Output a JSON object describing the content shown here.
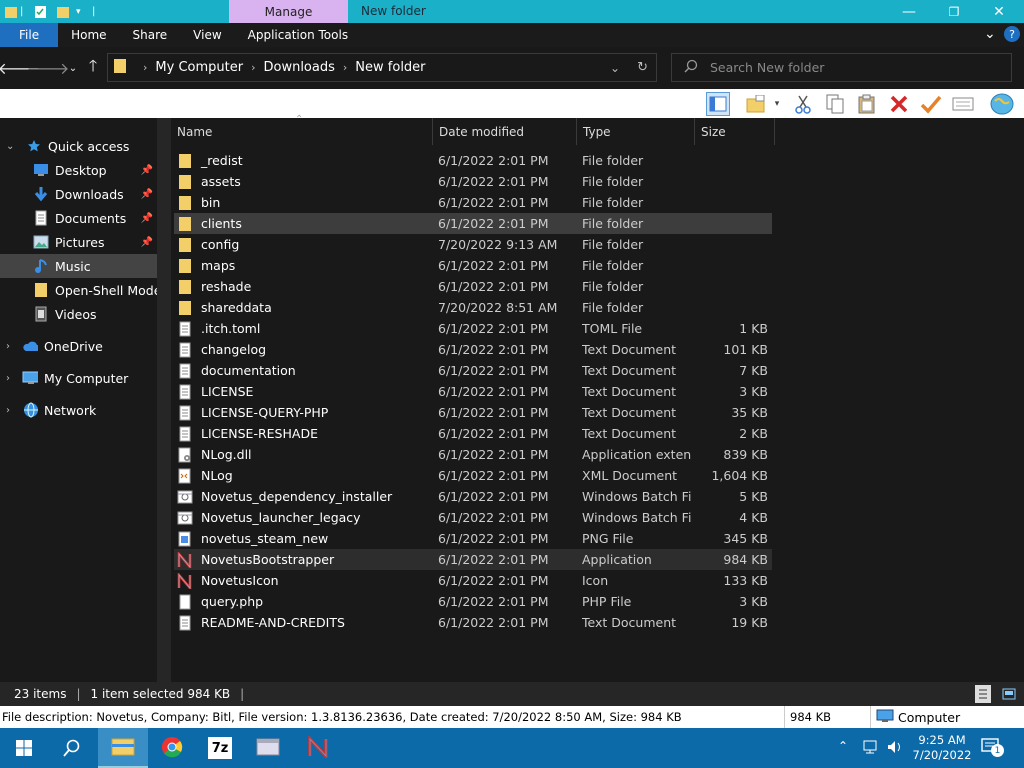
{
  "window": {
    "title": "New folder",
    "manage_tab": "Manage",
    "min_glyph": "—",
    "max_glyph": "❐",
    "close_glyph": "✕"
  },
  "ribbon": {
    "tabs": [
      "File",
      "Home",
      "Share",
      "View",
      "Application Tools"
    ],
    "chevron": "⌄",
    "help": "?"
  },
  "address": {
    "crumbs": [
      "My Computer",
      "Downloads",
      "New folder"
    ],
    "search_placeholder": "Search New folder"
  },
  "nav": {
    "quick_access": "Quick access",
    "items": [
      {
        "label": "Desktop",
        "icon": "desktop-icon",
        "pinned": true
      },
      {
        "label": "Downloads",
        "icon": "downloads-icon",
        "pinned": true
      },
      {
        "label": "Documents",
        "icon": "documents-icon",
        "pinned": true
      },
      {
        "label": "Pictures",
        "icon": "pictures-icon",
        "pinned": true
      },
      {
        "label": "Music",
        "icon": "music-icon",
        "pinned": false
      },
      {
        "label": "Open-Shell Modern",
        "icon": "folder-icon",
        "pinned": false
      },
      {
        "label": "Videos",
        "icon": "videos-icon",
        "pinned": false
      }
    ],
    "roots": [
      "OneDrive",
      "My Computer",
      "Network"
    ]
  },
  "columns": [
    "Name",
    "Date modified",
    "Type",
    "Size"
  ],
  "files": [
    {
      "name": "_redist",
      "date": "6/1/2022 2:01 PM",
      "type": "File folder",
      "size": "",
      "kind": "folder"
    },
    {
      "name": "assets",
      "date": "6/1/2022 2:01 PM",
      "type": "File folder",
      "size": "",
      "kind": "folder"
    },
    {
      "name": "bin",
      "date": "6/1/2022 2:01 PM",
      "type": "File folder",
      "size": "",
      "kind": "folder"
    },
    {
      "name": "clients",
      "date": "6/1/2022 2:01 PM",
      "type": "File folder",
      "size": "",
      "kind": "folder"
    },
    {
      "name": "config",
      "date": "7/20/2022 9:13 AM",
      "type": "File folder",
      "size": "",
      "kind": "folder"
    },
    {
      "name": "maps",
      "date": "6/1/2022 2:01 PM",
      "type": "File folder",
      "size": "",
      "kind": "folder"
    },
    {
      "name": "reshade",
      "date": "6/1/2022 2:01 PM",
      "type": "File folder",
      "size": "",
      "kind": "folder"
    },
    {
      "name": "shareddata",
      "date": "7/20/2022 8:51 AM",
      "type": "File folder",
      "size": "",
      "kind": "folder"
    },
    {
      "name": ".itch.toml",
      "date": "6/1/2022 2:01 PM",
      "type": "TOML File",
      "size": "1 KB",
      "kind": "doc"
    },
    {
      "name": "changelog",
      "date": "6/1/2022 2:01 PM",
      "type": "Text Document",
      "size": "101 KB",
      "kind": "doc"
    },
    {
      "name": "documentation",
      "date": "6/1/2022 2:01 PM",
      "type": "Text Document",
      "size": "7 KB",
      "kind": "doc"
    },
    {
      "name": "LICENSE",
      "date": "6/1/2022 2:01 PM",
      "type": "Text Document",
      "size": "3 KB",
      "kind": "doc"
    },
    {
      "name": "LICENSE-QUERY-PHP",
      "date": "6/1/2022 2:01 PM",
      "type": "Text Document",
      "size": "35 KB",
      "kind": "doc"
    },
    {
      "name": "LICENSE-RESHADE",
      "date": "6/1/2022 2:01 PM",
      "type": "Text Document",
      "size": "2 KB",
      "kind": "doc"
    },
    {
      "name": "NLog.dll",
      "date": "6/1/2022 2:01 PM",
      "type": "Application exten...",
      "size": "839 KB",
      "kind": "dll"
    },
    {
      "name": "NLog",
      "date": "6/1/2022 2:01 PM",
      "type": "XML Document",
      "size": "1,604 KB",
      "kind": "xml"
    },
    {
      "name": "Novetus_dependency_installer",
      "date": "6/1/2022 2:01 PM",
      "type": "Windows Batch File",
      "size": "5 KB",
      "kind": "bat"
    },
    {
      "name": "Novetus_launcher_legacy",
      "date": "6/1/2022 2:01 PM",
      "type": "Windows Batch File",
      "size": "4 KB",
      "kind": "bat"
    },
    {
      "name": "novetus_steam_new",
      "date": "6/1/2022 2:01 PM",
      "type": "PNG File",
      "size": "345 KB",
      "kind": "png"
    },
    {
      "name": "NovetusBootstrapper",
      "date": "6/1/2022 2:01 PM",
      "type": "Application",
      "size": "984 KB",
      "kind": "app"
    },
    {
      "name": "NovetusIcon",
      "date": "6/1/2022 2:01 PM",
      "type": "Icon",
      "size": "133 KB",
      "kind": "app"
    },
    {
      "name": "query.php",
      "date": "6/1/2022 2:01 PM",
      "type": "PHP File",
      "size": "3 KB",
      "kind": "blank"
    },
    {
      "name": "README-AND-CREDITS",
      "date": "6/1/2022 2:01 PM",
      "type": "Text Document",
      "size": "19 KB",
      "kind": "doc"
    }
  ],
  "selected_index": 3,
  "hover_index": 19,
  "status": {
    "items": "23 items",
    "selected": "1 item selected  984 KB"
  },
  "info": {
    "description": "File description: Novetus, Company: Bitl, File version: 1.3.8136.23636, Date created: 7/20/2022 8:50 AM, Size: 984 KB",
    "size": "984 KB",
    "location": "Computer"
  },
  "taskbar": {
    "time": "9:25 AM",
    "date": "7/20/2022",
    "notif_count": "1",
    "sevenzip_label": "7z"
  },
  "colors": {
    "accent": "#1ab0c8",
    "folder": "#f3cf6a",
    "file_tab": "#1f6fc0",
    "manage": "#d9b3f0",
    "taskbar": "#0c6aa8"
  }
}
